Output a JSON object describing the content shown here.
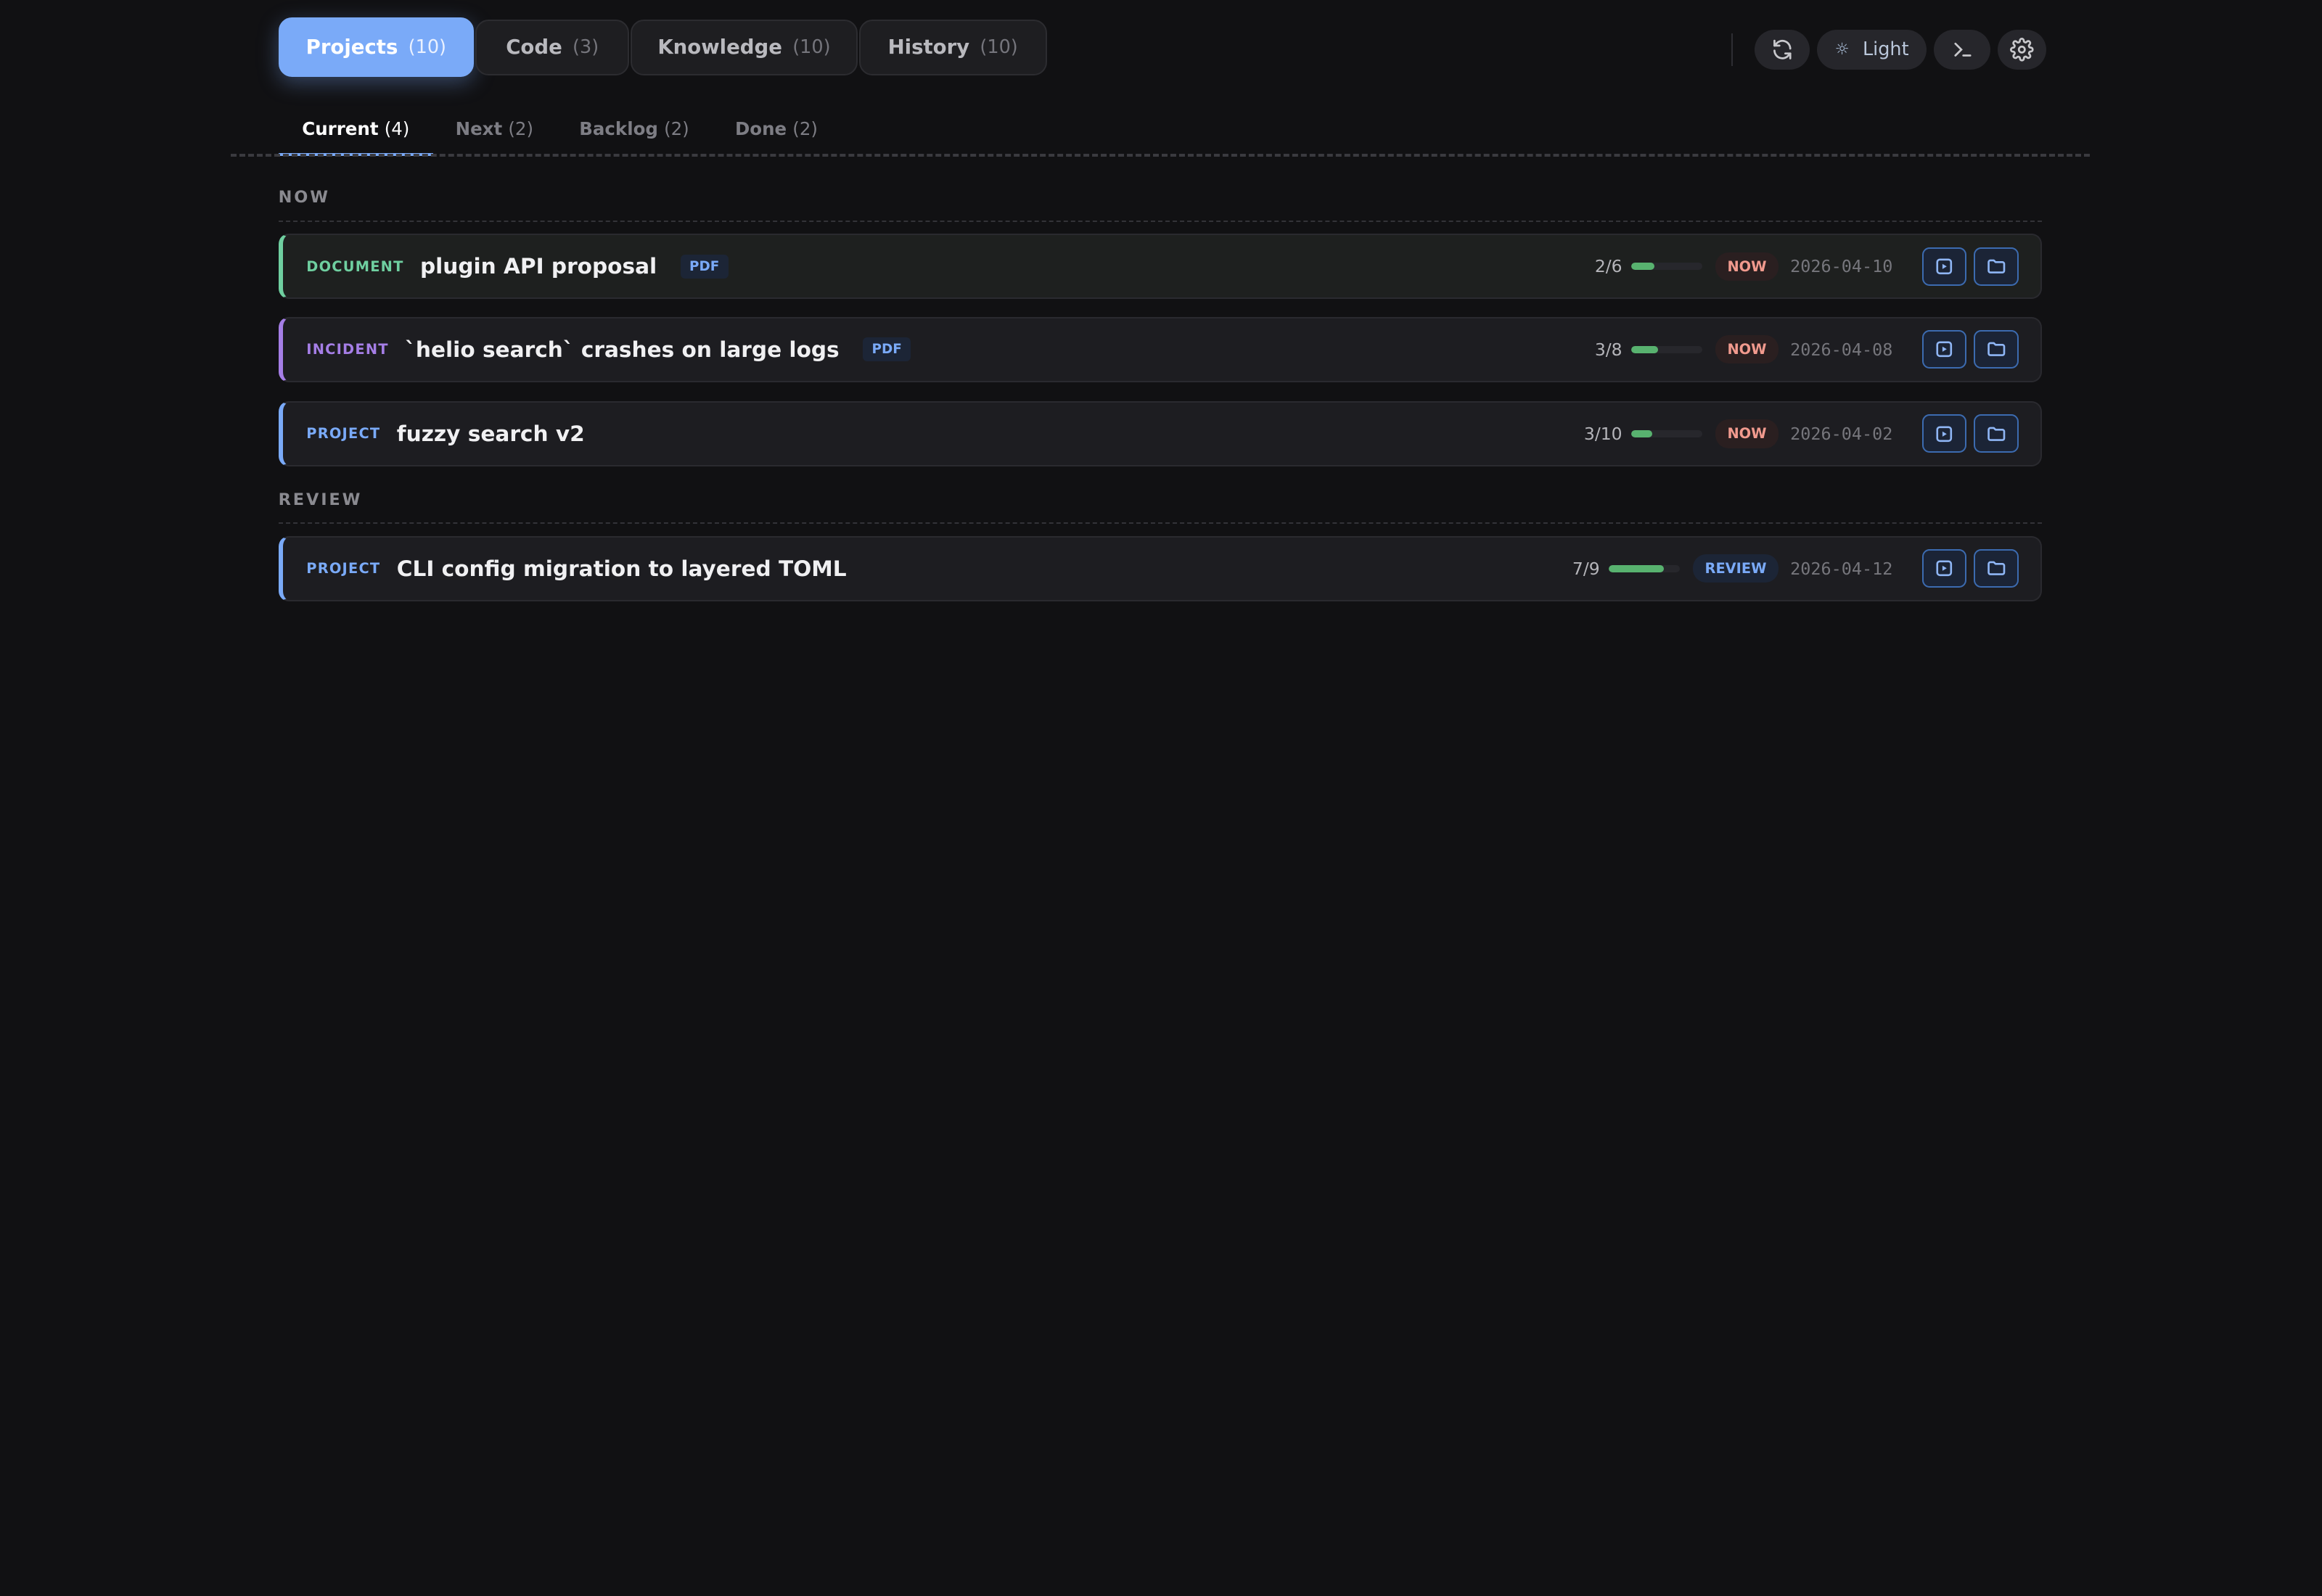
{
  "top_tabs": [
    {
      "label": "Projects",
      "count": "(10)"
    },
    {
      "label": "Code",
      "count": "(3)"
    },
    {
      "label": "Knowledge",
      "count": "(10)"
    },
    {
      "label": "History",
      "count": "(10)"
    }
  ],
  "toolbar": {
    "theme_label": "Light",
    "icons": [
      "refresh-icon",
      "sun-icon",
      "terminal-icon",
      "gear-icon"
    ]
  },
  "sub_tabs": [
    {
      "label": "Current",
      "count": "(4)"
    },
    {
      "label": "Next",
      "count": "(2)"
    },
    {
      "label": "Backlog",
      "count": "(2)"
    },
    {
      "label": "Done",
      "count": "(2)"
    }
  ],
  "sections": [
    {
      "label": "NOW"
    },
    {
      "label": "REVIEW"
    }
  ],
  "colors": {
    "accent": "#7aaaf8",
    "document": "#6fcfa0",
    "incident": "#a57ee6",
    "project": "#7aaaf8",
    "progress": "#58b26f",
    "now": "#f19a8e"
  },
  "items": [
    {
      "kind": "DOCUMENT",
      "title": "plugin API proposal",
      "pdf": "PDF",
      "progress": "2/6",
      "pct": 33,
      "status": "NOW",
      "date": "2026-04-10"
    },
    {
      "kind": "INCIDENT",
      "title": "`helio search` crashes on large logs",
      "pdf": "PDF",
      "progress": "3/8",
      "pct": 37.5,
      "status": "NOW",
      "date": "2026-04-08"
    },
    {
      "kind": "PROJECT",
      "title": "fuzzy search v2",
      "progress": "3/10",
      "pct": 30,
      "status": "NOW",
      "date": "2026-04-02"
    },
    {
      "kind": "PROJECT",
      "title": "CLI config migration to layered TOML",
      "progress": "7/9",
      "pct": 78,
      "status": "REVIEW",
      "date": "2026-04-12"
    }
  ]
}
